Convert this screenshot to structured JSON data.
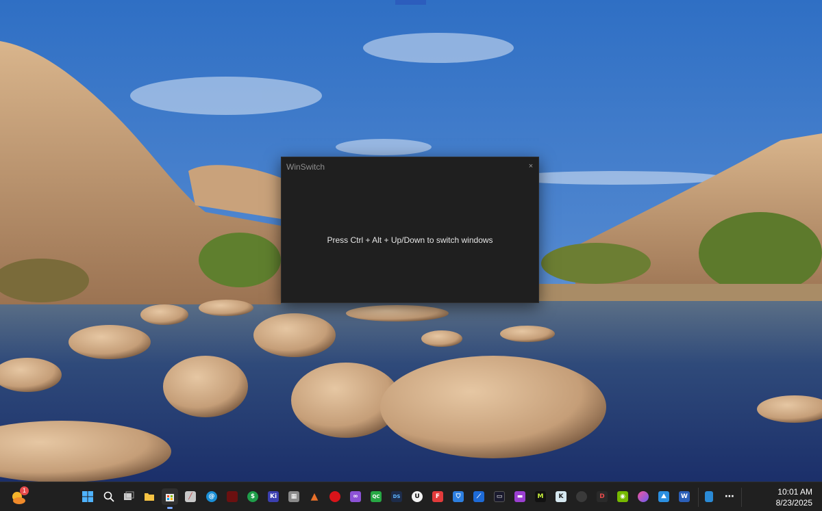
{
  "window": {
    "title": "WinSwitch",
    "close_glyph": "×",
    "message": "Press Ctrl + Alt + Up/Down to switch windows"
  },
  "taskbar": {
    "weather_badge": "1",
    "items": [
      {
        "name": "start-icon",
        "label": ""
      },
      {
        "name": "search-icon",
        "label": ""
      },
      {
        "name": "task-view-icon",
        "label": ""
      },
      {
        "name": "file-explorer-icon",
        "label": ""
      },
      {
        "name": "store-icon",
        "label": "",
        "active": true
      },
      {
        "name": "app-icon",
        "label": ""
      },
      {
        "name": "at-icon",
        "label": "@"
      },
      {
        "name": "app-icon",
        "label": ""
      },
      {
        "name": "dollar-icon",
        "label": "$"
      },
      {
        "name": "ki-icon",
        "label": "Ki"
      },
      {
        "name": "calculator-icon",
        "label": ""
      },
      {
        "name": "matlab-icon",
        "label": ""
      },
      {
        "name": "record-icon",
        "label": ""
      },
      {
        "name": "visual-studio-icon",
        "label": ""
      },
      {
        "name": "qc-icon",
        "label": "QC"
      },
      {
        "name": "ds-icon",
        "label": "DS"
      },
      {
        "name": "unreal-icon",
        "label": "U"
      },
      {
        "name": "f-icon",
        "label": "F"
      },
      {
        "name": "shield-icon",
        "label": ""
      },
      {
        "name": "blue-app-icon",
        "label": ""
      },
      {
        "name": "terminal-icon",
        "label": ""
      },
      {
        "name": "clapper-icon",
        "label": ""
      },
      {
        "name": "m-icon",
        "label": "M"
      },
      {
        "name": "k-icon",
        "label": "K"
      },
      {
        "name": "circle-icon",
        "label": ""
      },
      {
        "name": "d-icon",
        "label": "D"
      },
      {
        "name": "nvidia-icon",
        "label": ""
      },
      {
        "name": "copilot-icon",
        "label": ""
      },
      {
        "name": "image-icon",
        "label": ""
      },
      {
        "name": "word-icon",
        "label": "W"
      },
      {
        "name": "notepad-icon",
        "label": ""
      },
      {
        "name": "more-icon",
        "label": "⋯"
      }
    ],
    "clock": {
      "time": "10:01 AM",
      "date": "8/23/2025"
    }
  }
}
